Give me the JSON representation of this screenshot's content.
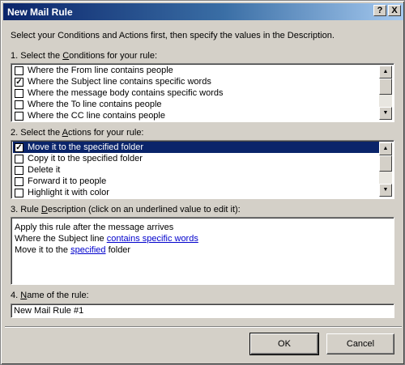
{
  "window": {
    "title": "New Mail Rule",
    "help_label": "?",
    "close_label": "X"
  },
  "intro": "Select your Conditions and Actions first, then specify the values in the Description.",
  "conditions": {
    "label_pre": "1. Select the ",
    "label_key": "C",
    "label_post": "onditions for your rule:",
    "items": [
      {
        "label": "Where the From line contains people",
        "checked": false
      },
      {
        "label": "Where the Subject line contains specific words",
        "checked": true
      },
      {
        "label": "Where the message body contains specific words",
        "checked": false
      },
      {
        "label": "Where the To line contains people",
        "checked": false
      },
      {
        "label": "Where the CC line contains people",
        "checked": false
      }
    ]
  },
  "actions": {
    "label_pre": "2. Select the ",
    "label_key": "A",
    "label_post": "ctions for your rule:",
    "items": [
      {
        "label": "Move it to the specified folder",
        "checked": true,
        "selected": true
      },
      {
        "label": "Copy it to the specified folder",
        "checked": false
      },
      {
        "label": "Delete it",
        "checked": false
      },
      {
        "label": "Forward it to people",
        "checked": false
      },
      {
        "label": "Highlight it with color",
        "checked": false
      }
    ]
  },
  "description": {
    "label_pre": "3. Rule ",
    "label_key": "D",
    "label_post": "escription (click on an underlined value to edit it):",
    "line1": "Apply this rule after the message arrives",
    "line2_pre": "Where the Subject line ",
    "line2_link": "contains specific words",
    "line3_pre": "Move it to the ",
    "line3_link": "specified",
    "line3_post": " folder"
  },
  "name": {
    "label_pre": "4. ",
    "label_key": "N",
    "label_post": "ame of the rule:",
    "value": "New Mail Rule #1"
  },
  "buttons": {
    "ok": "OK",
    "cancel": "Cancel"
  },
  "icons": {
    "check": "✓",
    "arrow_up": "▲",
    "arrow_down": "▼"
  }
}
